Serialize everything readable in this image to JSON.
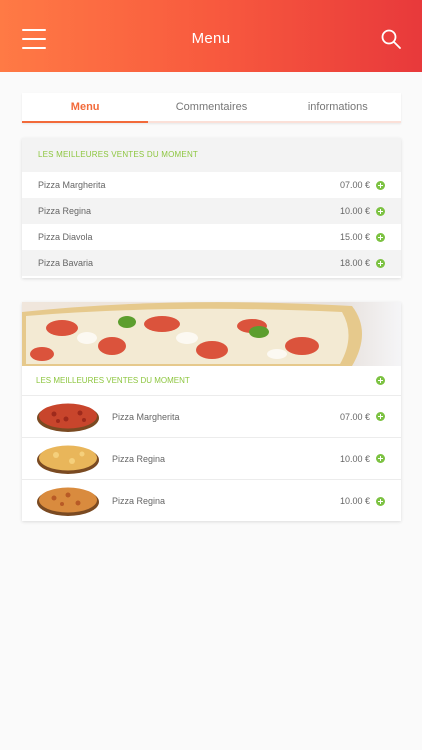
{
  "header": {
    "title": "Menu",
    "menu_icon": "hamburger-icon",
    "search_icon": "search-icon"
  },
  "tabs": [
    {
      "label": "Menu",
      "active": true
    },
    {
      "label": "Commentaires",
      "active": false
    },
    {
      "label": "informations",
      "active": false
    }
  ],
  "bestsellers_list": {
    "heading": "LES MEILLEURES VENTES DU MOMENT",
    "items": [
      {
        "name": "Pizza Margherita",
        "price": "07.00 €"
      },
      {
        "name": "Pizza Regina",
        "price": "10.00 €"
      },
      {
        "name": "Pizza Diavola",
        "price": "15.00 €"
      },
      {
        "name": "Pizza Bavaria",
        "price": "18.00 €"
      }
    ]
  },
  "bestsellers_cards": {
    "heading": "LES MEILLEURES VENTES DU MOMENT",
    "items": [
      {
        "name": "Pizza Margherita",
        "price": "07.00 €"
      },
      {
        "name": "Pizza Regina",
        "price": "10.00 €"
      },
      {
        "name": "Pizza Regina",
        "price": "10.00 €"
      }
    ]
  },
  "colors": {
    "accent": "#f26a3a",
    "green": "#7cc242",
    "header_start": "#ff7a45",
    "header_end": "#e8393b"
  }
}
